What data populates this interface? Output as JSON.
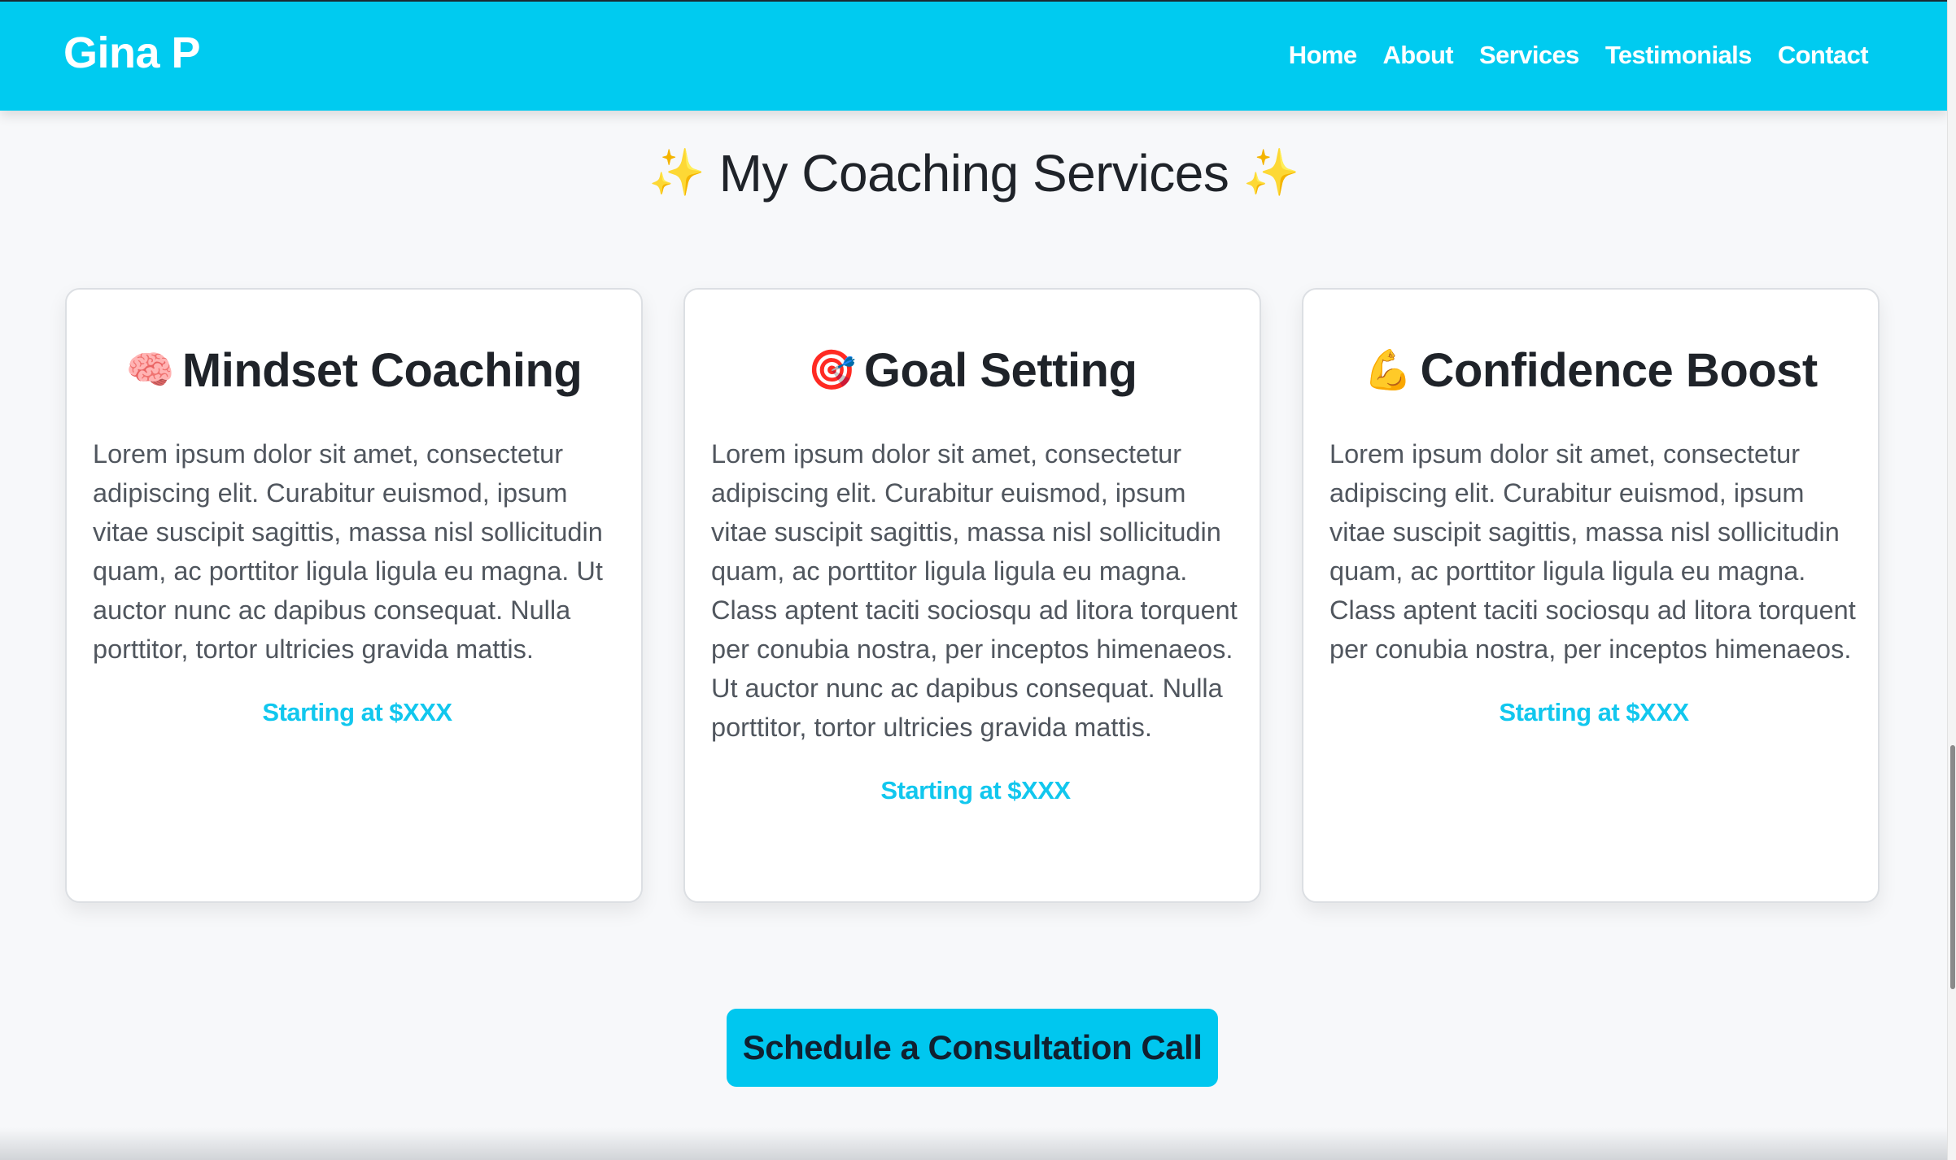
{
  "navbar": {
    "brand": "Gina P",
    "links": [
      "Home",
      "About",
      "Services",
      "Testimonials",
      "Contact"
    ],
    "background_color": "#00cbf0"
  },
  "services": {
    "title": "My Coaching Services",
    "sparkle_icon": "✨",
    "cards": [
      {
        "emoji": "🧠",
        "title": "Mindset Coaching",
        "body": "Lorem ipsum dolor sit amet, consectetur adipiscing elit. Curabitur euismod, ipsum vitae suscipit sagittis, massa nisl sollicitudin quam, ac porttitor ligula ligula eu magna. Ut auctor nunc ac dapibus consequat. Nulla porttitor, tortor ultricies gravida mattis.",
        "price": "Starting at $XXX"
      },
      {
        "emoji": "🎯",
        "title": "Goal Setting",
        "body": "Lorem ipsum dolor sit amet, consectetur adipiscing elit. Curabitur euismod, ipsum vitae suscipit sagittis, massa nisl sollicitudin quam, ac porttitor ligula ligula eu magna. Class aptent taciti sociosqu ad litora torquent per conubia nostra, per inceptos himenaeos. Ut auctor nunc ac dapibus consequat. Nulla porttitor, tortor ultricies gravida mattis.",
        "price": "Starting at $XXX"
      },
      {
        "emoji": "💪",
        "title": "Confidence Boost",
        "body": "Lorem ipsum dolor sit amet, consectetur adipiscing elit. Curabitur euismod, ipsum vitae suscipit sagittis, massa nisl sollicitudin quam, ac porttitor ligula ligula eu magna. Class aptent taciti sociosqu ad litora torquent per conubia nostra, per inceptos himenaeos.",
        "price": "Starting at $XXX"
      }
    ]
  },
  "cta": {
    "label": "Schedule a Consultation Call",
    "color": "#00c7ef"
  },
  "colors": {
    "accent": "#00cbf0",
    "price_text": "#11c7ee",
    "page_background": "#f7f8fa"
  }
}
